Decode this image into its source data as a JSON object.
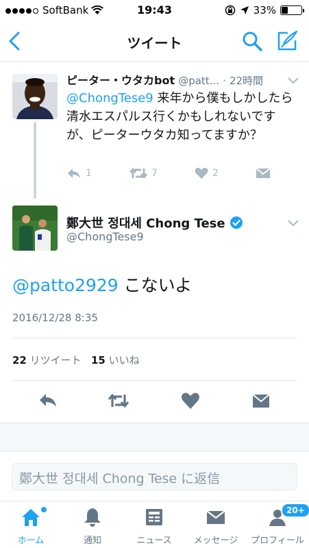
{
  "status_bar": {
    "carrier": "SoftBank",
    "time": "19:43",
    "battery": "33%",
    "battery_level": 0.33
  },
  "nav": {
    "title": "ツイート"
  },
  "original_tweet": {
    "name": "ピーター・ウタカbot",
    "handle": "@patt...",
    "time": "22時間",
    "mention": "@ChongTese9",
    "text": " 来年から僕もしかしたら清水エスパルス行くかもしれないですが、ピーターウタカ知ってますか？",
    "reply_count": "1",
    "retweet_count": "7",
    "like_count": "2"
  },
  "main_tweet": {
    "name": "鄭大世 정대세 Chong Tese",
    "handle": "@ChongTese9",
    "mention": "@patto2929",
    "text": " こないよ",
    "timestamp": "2016/12/28 8:35",
    "retweets_count": "22",
    "retweets_label": "リツイート",
    "likes_count": "15",
    "likes_label": "いいね"
  },
  "reply": {
    "placeholder": "鄭大世 정대세 Chong Tese に返信"
  },
  "tabs": [
    {
      "label": "ホーム",
      "icon": "home-icon",
      "active": true
    },
    {
      "label": "通知",
      "icon": "bell-icon"
    },
    {
      "label": "ニュース",
      "icon": "news-icon"
    },
    {
      "label": "メッセージ",
      "icon": "envelope-icon"
    },
    {
      "label": "プロフィール",
      "icon": "profile-icon",
      "badge": "20+"
    }
  ],
  "colors": {
    "accent": "#1da1f2",
    "muted": "#657786",
    "icon_gray": "#aab8c2"
  }
}
